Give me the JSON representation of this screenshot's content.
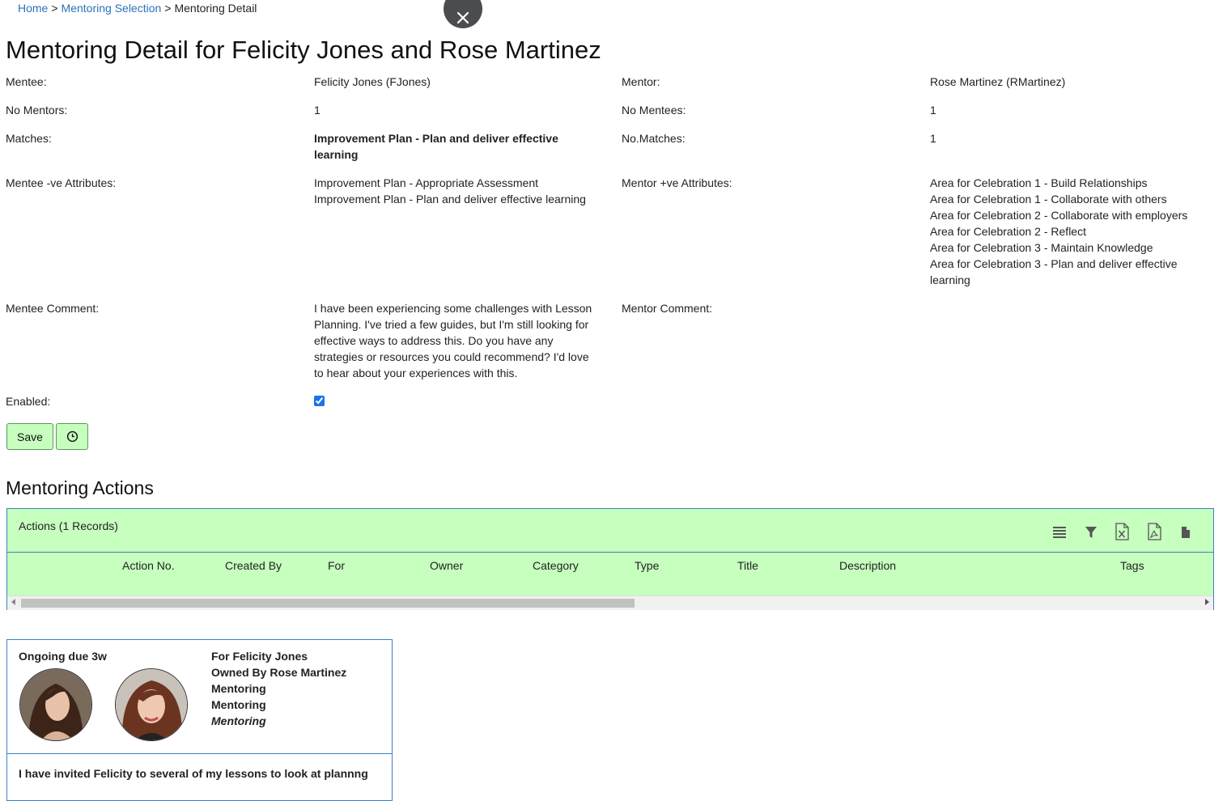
{
  "breadcrumb": {
    "home": "Home",
    "sep1": ">",
    "selection": "Mentoring Selection",
    "sep2": ">",
    "current": "Mentoring Detail"
  },
  "page_title": "Mentoring Detail for Felicity Jones and Rose Martinez",
  "details": {
    "mentee_label": "Mentee:",
    "mentee_value": "Felicity Jones (FJones)",
    "mentor_label": "Mentor:",
    "mentor_value": "Rose Martinez (RMartinez)",
    "no_mentors_label": "No Mentors:",
    "no_mentors_value": "1",
    "no_mentees_label": "No Mentees:",
    "no_mentees_value": "1",
    "matches_label": "Matches:",
    "matches_value_1": "Improvement Plan - Plan and deliver effective",
    "matches_value_2": "learning",
    "no_matches_label": "No.Matches:",
    "no_matches_value": "1",
    "mentee_attr_label": "Mentee -ve Attributes:",
    "mentee_attrs": [
      "Improvement Plan - Appropriate Assessment",
      "Improvement Plan - Plan and deliver effective learning"
    ],
    "mentor_attr_label": "Mentor +ve Attributes:",
    "mentor_attrs": [
      "Area for Celebration 1 - Build Relationships",
      "Area for Celebration 1 - Collaborate with others",
      "Area for Celebration 2 - Collaborate with employers",
      "Area for Celebration 2 - Reflect",
      "Area for Celebration 3 - Maintain Knowledge",
      "Area for Celebration 3 - Plan and deliver effective",
      "learning"
    ],
    "mentee_comment_label": "Mentee Comment:",
    "mentee_comment": [
      "I have been experiencing some challenges with Lesson",
      "Planning. I've tried a few guides, but I'm still looking for",
      "effective ways to address this. Do you have any",
      "strategies or resources you could recommend? I'd love",
      "to hear about your experiences with this."
    ],
    "mentor_comment_label": "Mentor Comment:",
    "enabled_label": "Enabled:"
  },
  "buttons": {
    "save": "Save"
  },
  "actions_section": {
    "title": "Mentoring Actions",
    "caption": "Actions (1 Records)",
    "columns": [
      "Action No.",
      "Created By",
      "For",
      "Owner",
      "Category",
      "Type",
      "Title",
      "Description",
      "Tags"
    ]
  },
  "card": {
    "status": "Ongoing due 3w",
    "for": "For Felicity Jones",
    "owned_by": "Owned By Rose Martinez",
    "category": "Mentoring",
    "type": "Mentoring",
    "title": "Mentoring",
    "description": "I have invited Felicity to several of my lessons to look at plannng"
  },
  "colors": {
    "accent_green": "#c6ffbe",
    "border_blue": "#3b82c4",
    "link": "#2a73b8"
  }
}
